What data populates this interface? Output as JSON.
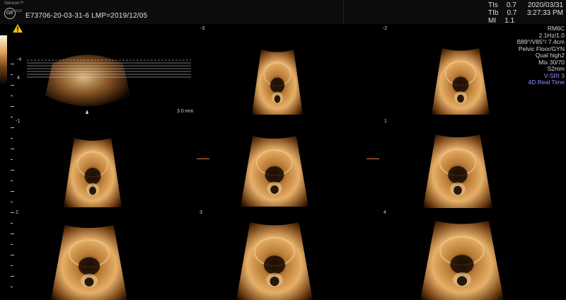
{
  "header": {
    "brand": "Voluson™",
    "logo": "GE",
    "model": "E10",
    "patient_line": "E73706-20-03-31-6    LMP=2019/12/05",
    "indices": [
      {
        "label": "TIs",
        "value": "0.7"
      },
      {
        "label": "TIb",
        "value": "0.7"
      },
      {
        "label": "MI",
        "value": "1.1"
      }
    ],
    "date": "2020/03/31",
    "time": "3:27:33 PM"
  },
  "params": {
    "probe": "RM6C",
    "freq": "2.1Hz/1.0",
    "angles": "B89°/V85°/ 7.4cm",
    "preset": "Pelvic Floor/GYN",
    "quality": "Qual high2",
    "mix": "Mix 30/70",
    "slice": "S2mm",
    "mode1": "V-SRI 3",
    "mode2": "4D Real Time"
  },
  "slice_thickness": "3.0 mm",
  "slice_labels": [
    "-3",
    "-2",
    "-1",
    "1",
    "2",
    "3",
    "4"
  ],
  "ref_marks": [
    "-4",
    "4"
  ],
  "icons": {
    "warning": "warning-icon",
    "logo": "ge-logo-icon"
  },
  "colors": {
    "background": "#000000",
    "tissue": "#c88a45",
    "accent_blue": "#8f8fff",
    "marker": "#e07a3a"
  }
}
